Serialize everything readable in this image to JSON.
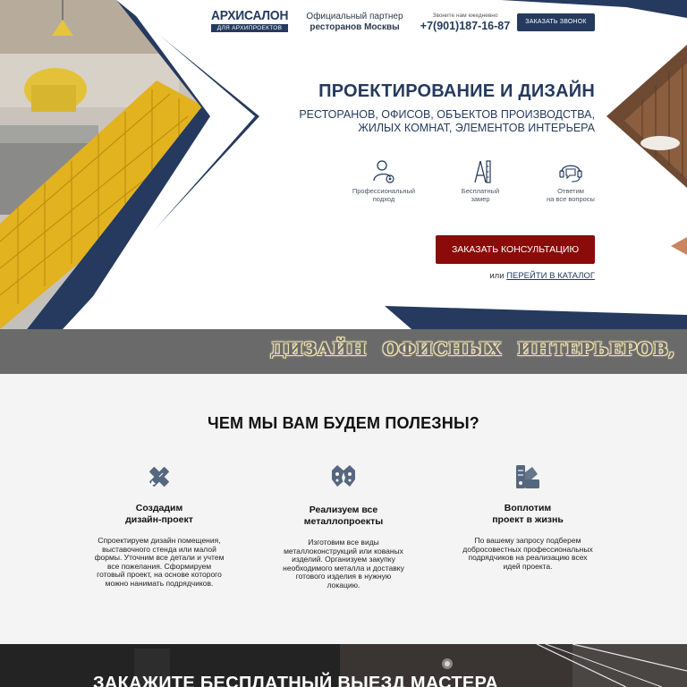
{
  "header": {
    "logo_main": "АРХИСАЛОН",
    "logo_sub": "ДЛЯ АРХИПРОЕКТОВ",
    "partner_line1": "Официальный партнер",
    "partner_line2": "ресторанов Москвы",
    "phone_label": "Звоните нам ежедневно",
    "phone_number": "+7(901)187-16-87",
    "call_button": "ЗАКАЗАТЬ ЗВОНОК"
  },
  "hero": {
    "title": "ПРОЕКТИРОВАНИЕ И ДИЗАЙН",
    "subtitle_line1": "РЕСТОРАНОВ, ОФИСОВ, ОБЪЕКТОВ ПРОИЗВОДСТВА,",
    "subtitle_line2": "ЖИЛЫХ КОМНАТ, ЭЛЕМЕНТОВ ИНТЕРЬЕРА",
    "features": [
      {
        "icon": "user-gear-icon",
        "line1": "Профессиональный",
        "line2": "подход"
      },
      {
        "icon": "ruler-icon",
        "line1": "Бесплатный",
        "line2": "замер"
      },
      {
        "icon": "support-chat-icon",
        "line1": "Ответим",
        "line2": "на все вопросы"
      }
    ],
    "consult_button": "ЗАКАЗАТЬ КОНСУЛЬТАЦИЮ",
    "catalog_prefix": "или",
    "catalog_link": "ПЕРЕЙТИ В КАТАЛОГ"
  },
  "band": {
    "text": "ДИЗАЙН ОФИСНЫХ ИНТЕРЬЕРОВ, РЕСТОРАНОВ, ВЫ"
  },
  "benefits": {
    "title": "ЧЕМ МЫ ВАМ БУДЕМ ПОЛЕЗНЫ?",
    "items": [
      {
        "icon": "pencil-ruler-icon",
        "title1": "Создадим",
        "title2": "дизайн-проект",
        "text": [
          "Спроектируем дизайн помещения,",
          "выставочного стенда или малой",
          "формы. Уточним все детали и учтем",
          "все пожелания. Сформируем",
          "готовый проект, на основе которого",
          "можно нанимать подрядчиков."
        ]
      },
      {
        "icon": "metal-ornament-icon",
        "title1": "Реализуем все",
        "title2": "металлопроекты",
        "text": [
          "Изготовим все виды",
          "металлоконструкций или кованых",
          "изделий. Организуем закупку",
          "необходимого металла и доставку",
          "готового изделия в нужную",
          "локацию."
        ]
      },
      {
        "icon": "swatches-icon",
        "title1": "Воплотим",
        "title2": "проект в жизнь",
        "text": [
          "По вашему запросу подберем",
          "добросовестных профессиональных",
          "подрядчиков на реализацию всех",
          "идей проекта."
        ]
      }
    ]
  },
  "bottom": {
    "title": "ЗАКАЖИТЕ БЕСПЛАТНЫЙ ВЫЕЗД МАСТЕРА"
  },
  "colors": {
    "navy": "#253a5e",
    "accent_red": "#8b0a0a",
    "band_gray": "#6a6a6a",
    "bg_light": "#f4f4f4"
  }
}
